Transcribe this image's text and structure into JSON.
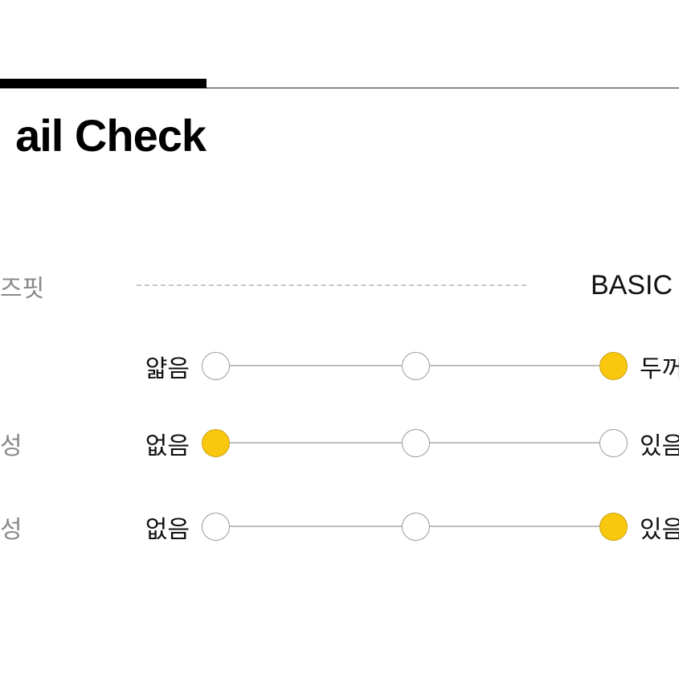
{
  "header": {
    "title": "ail Check"
  },
  "fit_row": {
    "label": "즈핏",
    "value": "BASIC"
  },
  "accent_color": "#f9c80e",
  "sliders": [
    {
      "label": "",
      "left": "얇음",
      "right": "두꺼",
      "selected": 2
    },
    {
      "label": "성",
      "left": "없음",
      "right": "있음",
      "selected": 0
    },
    {
      "label": "성",
      "left": "없음",
      "right": "있음",
      "selected": 2
    }
  ]
}
